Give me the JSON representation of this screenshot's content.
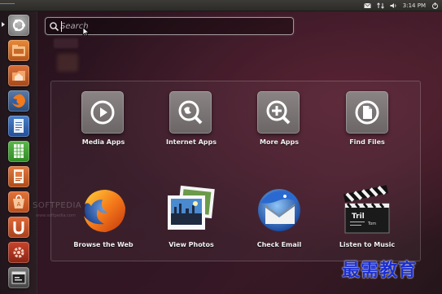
{
  "top_panel": {
    "clock": "3:14 PM",
    "indicators": [
      "mail-icon",
      "network-icon",
      "volume-icon",
      "power-icon"
    ]
  },
  "search": {
    "placeholder": "Search",
    "value": ""
  },
  "launcher": {
    "items": [
      {
        "name": "dash-home",
        "icon": "ubuntu-logo-icon",
        "running": true
      },
      {
        "name": "home-folder",
        "icon": "folder-icon",
        "running": false
      },
      {
        "name": "files",
        "icon": "orange-folder-icon",
        "running": false
      },
      {
        "name": "firefox",
        "icon": "firefox-icon",
        "running": false
      },
      {
        "name": "writer",
        "icon": "document-icon",
        "running": false
      },
      {
        "name": "calc",
        "icon": "spreadsheet-icon",
        "running": false
      },
      {
        "name": "impress",
        "icon": "presentation-icon",
        "running": false
      },
      {
        "name": "software-center",
        "icon": "software-center-icon",
        "running": false
      },
      {
        "name": "ubuntu-one",
        "icon": "ubuntu-one-icon",
        "running": false
      },
      {
        "name": "settings",
        "icon": "gear-icon",
        "running": false
      },
      {
        "name": "workspaces",
        "icon": "workspace-switcher-icon",
        "running": false
      }
    ]
  },
  "shortcuts": {
    "lenses": [
      {
        "label": "Media Apps",
        "icon": "play-icon"
      },
      {
        "label": "Internet Apps",
        "icon": "globe-icon"
      },
      {
        "label": "More Apps",
        "icon": "plus-icon"
      },
      {
        "label": "Find Files",
        "icon": "file-search-icon"
      }
    ],
    "apps": [
      {
        "label": "Browse the Web",
        "icon": "firefox-icon"
      },
      {
        "label": "View Photos",
        "icon": "photos-icon"
      },
      {
        "label": "Check Email",
        "icon": "thunderbird-icon"
      },
      {
        "label": "Listen to Music",
        "icon": "clapperboard-music-icon"
      }
    ]
  },
  "watermarks": {
    "softpedia": "SOFTPEDIA",
    "softpedia_url": "www.softpedia.com",
    "site": "最需教育"
  },
  "colors": {
    "accent_blue": "#1a2ed0",
    "ubuntu_orange": "#dd4814",
    "panel": "#2c2b28"
  }
}
